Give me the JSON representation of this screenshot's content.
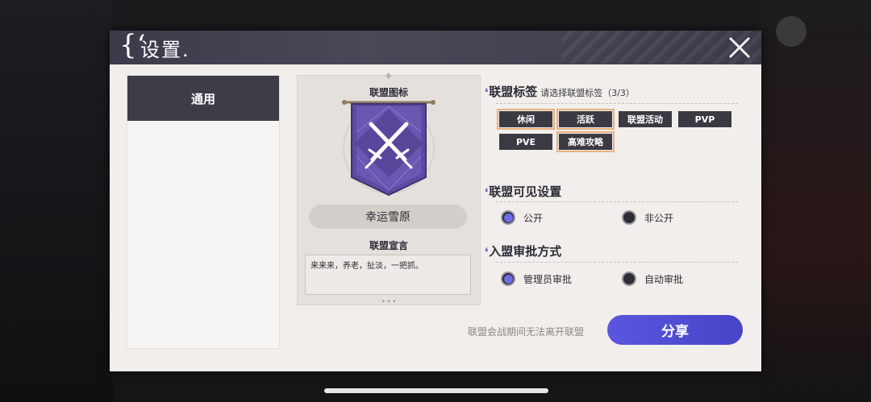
{
  "dialog": {
    "title": "设置",
    "title_prefix": "{‘",
    "title_suffix": "."
  },
  "nav": {
    "items": [
      {
        "label": "通用",
        "active": true
      }
    ]
  },
  "emblem": {
    "label": "联盟图标",
    "name": "幸运雪原",
    "declaration_label": "联盟宣言",
    "declaration_text": "来来来，养老，扯淡，一把抓。"
  },
  "tags_section": {
    "title": "联盟标签",
    "hint": "请选择联盟标签（3/3）",
    "tags": [
      {
        "label": "休闲",
        "selected": true
      },
      {
        "label": "活跃",
        "selected": true
      },
      {
        "label": "联盟活动",
        "selected": false
      },
      {
        "label": "PVP",
        "selected": false
      },
      {
        "label": "PVE",
        "selected": false
      },
      {
        "label": "高难攻略",
        "selected": true
      }
    ]
  },
  "visibility_section": {
    "title": "联盟可见设置",
    "options": [
      {
        "label": "公开",
        "selected": true
      },
      {
        "label": "非公开",
        "selected": false
      }
    ]
  },
  "approval_section": {
    "title": "入盟审批方式",
    "options": [
      {
        "label": "管理员审批",
        "selected": true
      },
      {
        "label": "自动审批",
        "selected": false
      }
    ]
  },
  "footer": {
    "note": "联盟会战期间无法离开联盟",
    "share_label": "分享"
  },
  "colors": {
    "accent": "#5250d8",
    "dark": "#3b3942",
    "tag_outline": "#e8b07e",
    "panel": "#f1eeec"
  }
}
